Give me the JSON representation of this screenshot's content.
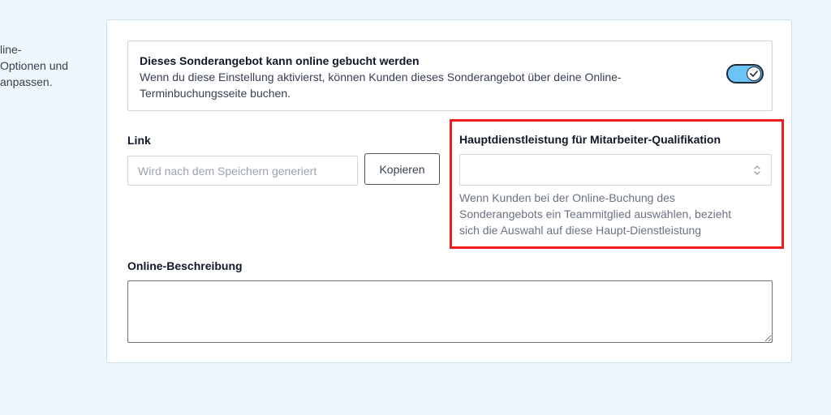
{
  "sidebar": {
    "description_lines": [
      "line-",
      "Optionen und",
      "anpassen."
    ]
  },
  "online_booking": {
    "title": "Dieses Sonderangebot kann online gebucht werden",
    "description": "Wenn du diese Einstellung aktivierst, können Kunden dieses Sonderangebot über deine Online-Terminbuchungsseite buchen.",
    "enabled": true,
    "toggle_icon": "check-icon"
  },
  "link": {
    "label": "Link",
    "placeholder": "Wird nach dem Speichern generiert",
    "value": "",
    "copy_label": "Kopieren"
  },
  "main_service": {
    "label": "Hauptdienstleistung für Mitarbeiter-Qualifikation",
    "selected": "",
    "help_lines": [
      "Wenn Kunden bei der Online-Buchung des",
      "Sonderangebots ein Teammitglied auswählen, bezieht",
      "sich die Auswahl auf diese Haupt-Dienstleistung"
    ],
    "highlight_color": "#ee1c1c"
  },
  "online_description": {
    "label": "Online-Beschreibung",
    "value": ""
  },
  "colors": {
    "background": "#eef7fd",
    "toggle_on": "#6cc3f5",
    "highlight": "#ee1c1c"
  }
}
